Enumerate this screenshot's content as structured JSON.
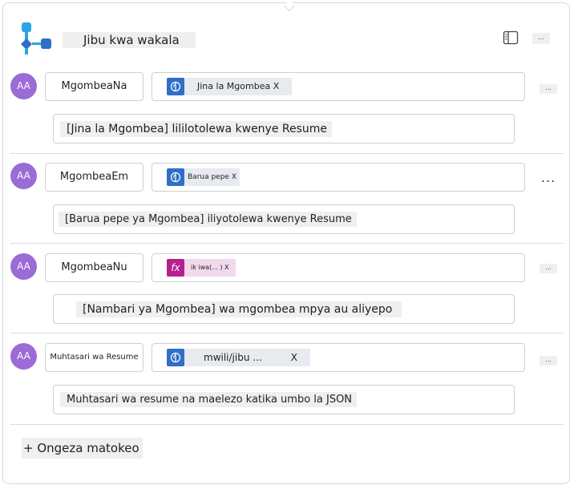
{
  "header": {
    "title": "Jibu kwa wakala",
    "app_icon": "agent-flow-icon",
    "panel_icon": "side-panel-icon",
    "more_label": "..."
  },
  "outputs": [
    {
      "avatar": "AA",
      "name": "MgombeaNa",
      "type_icon": "ai-brain-icon",
      "type_label": "Jina la Mgombea X",
      "more_label": "...",
      "description": "[Jina la Mgombea] lililotolewa kwenye Resume"
    },
    {
      "avatar": "AA",
      "name": "MgombeaEm",
      "type_icon": "ai-brain-icon",
      "type_label": "Barua pepe X",
      "more_label": "...",
      "description": "[Barua pepe ya Mgombea] iliyotolewa kwenye Resume"
    },
    {
      "avatar": "AA",
      "name": "MgombeaNu",
      "type_icon": "fx-icon",
      "type_label": "ik iwa(... ) X",
      "more_label": "...",
      "description": "[Nambari ya Mgombea] wa mgombea mpya au aliyepo"
    },
    {
      "avatar": "AA",
      "name": "Muhtasari wa Resume",
      "type_icon": "ai-brain-icon",
      "type_label": "mwili/jibu ...",
      "type_close": "X",
      "more_label": "...",
      "description": "Muhtasari wa resume na maelezo katika umbo la JSON"
    }
  ],
  "footer": {
    "add_label": "+ Ongeza matokeo"
  },
  "colors": {
    "avatar": "#9b6bd6",
    "ai_chip": "#2f6fc7",
    "fx_chip": "#b6208d"
  }
}
